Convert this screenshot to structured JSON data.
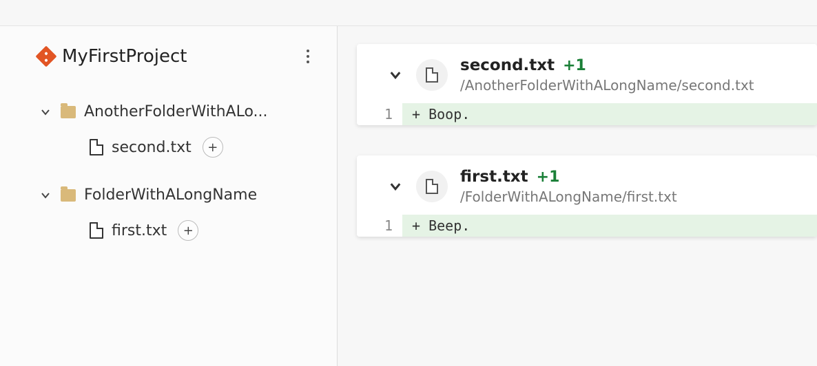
{
  "project": {
    "title": "MyFirstProject"
  },
  "sidebar": {
    "folders": [
      {
        "name": "AnotherFolderWithALo...",
        "files": [
          {
            "name": "second.txt",
            "badge": "+"
          }
        ]
      },
      {
        "name": "FolderWithALongName",
        "files": [
          {
            "name": "first.txt",
            "badge": "+"
          }
        ]
      }
    ]
  },
  "diffs": [
    {
      "filename": "second.txt",
      "change_count": "+1",
      "path": "/AnotherFolderWithALongName/second.txt",
      "lines": [
        {
          "n": "1",
          "text": "+ Boop."
        }
      ]
    },
    {
      "filename": "first.txt",
      "change_count": "+1",
      "path": "/FolderWithALongName/first.txt",
      "lines": [
        {
          "n": "1",
          "text": "+ Beep."
        }
      ]
    }
  ]
}
